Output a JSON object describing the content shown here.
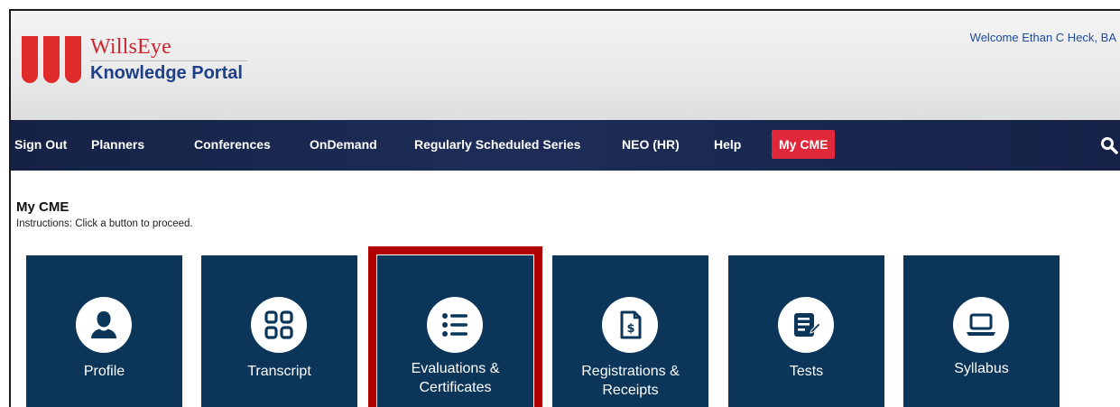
{
  "header": {
    "brand_top": "WillsEye",
    "brand_bottom": "Knowledge Portal",
    "welcome": "Welcome Ethan C Heck, BA"
  },
  "nav": {
    "items": [
      {
        "label": "Sign Out"
      },
      {
        "label": "Planners"
      },
      {
        "label": "Conferences"
      },
      {
        "label": "OnDemand"
      },
      {
        "label": "Regularly Scheduled Series"
      },
      {
        "label": "NEO (HR)"
      },
      {
        "label": "Help"
      },
      {
        "label": "My CME",
        "active": true
      }
    ],
    "search_icon": "search-icon",
    "active_color": "#e0283a"
  },
  "main": {
    "title": "My CME",
    "instructions": "Instructions: Click a button to proceed.",
    "tiles": [
      {
        "label_lines": [
          "Profile"
        ],
        "icon": "person-icon"
      },
      {
        "label_lines": [
          "Transcript"
        ],
        "icon": "grid-icon"
      },
      {
        "label_lines": [
          "Evaluations &",
          "Certificates"
        ],
        "icon": "list-icon",
        "highlighted": true
      },
      {
        "label_lines": [
          "Registrations &",
          "Receipts"
        ],
        "icon": "receipt-icon"
      },
      {
        "label_lines": [
          "Tests"
        ],
        "icon": "document-icon"
      },
      {
        "label_lines": [
          "Syllabus"
        ],
        "icon": "laptop-icon"
      }
    ],
    "tile_color": "#0b3559",
    "highlight_color": "#b00000"
  }
}
